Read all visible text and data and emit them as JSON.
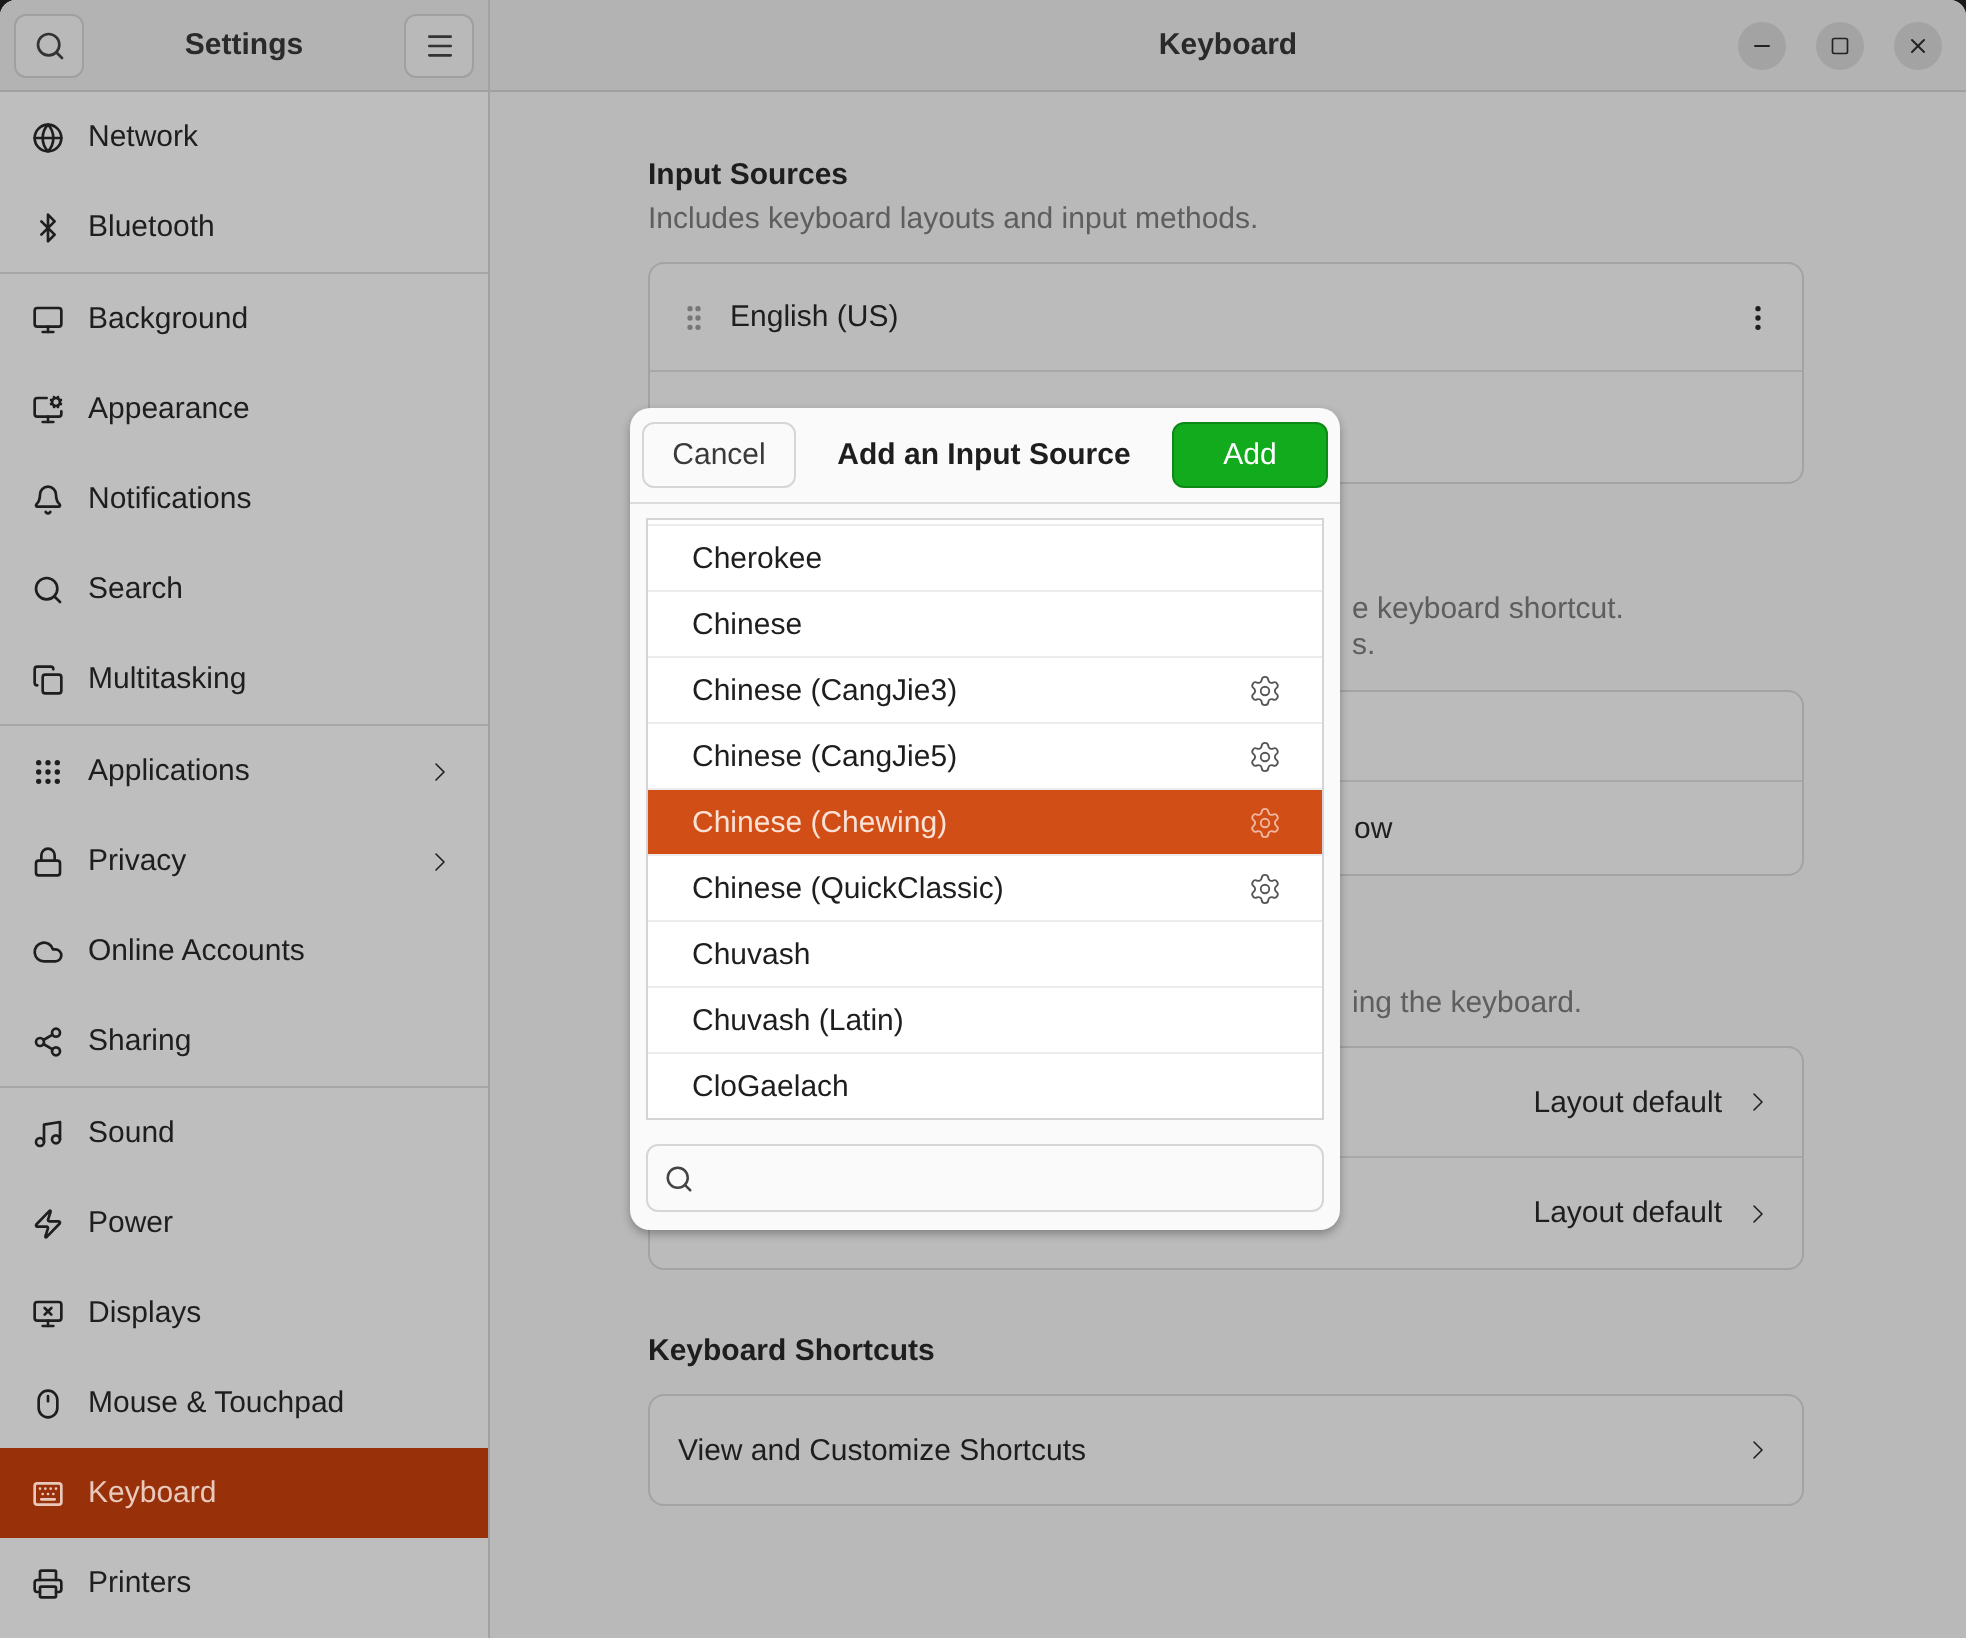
{
  "sidebar": {
    "title": "Settings",
    "groups": [
      {
        "items": [
          {
            "label": "Network",
            "selected": false,
            "submenu": false
          },
          {
            "label": "Bluetooth",
            "selected": false,
            "submenu": false
          }
        ]
      },
      {
        "items": [
          {
            "label": "Background",
            "selected": false,
            "submenu": false
          },
          {
            "label": "Appearance",
            "selected": false,
            "submenu": false
          },
          {
            "label": "Notifications",
            "selected": false,
            "submenu": false
          },
          {
            "label": "Search",
            "selected": false,
            "submenu": false
          },
          {
            "label": "Multitasking",
            "selected": false,
            "submenu": false
          }
        ]
      },
      {
        "items": [
          {
            "label": "Applications",
            "selected": false,
            "submenu": true
          },
          {
            "label": "Privacy",
            "selected": false,
            "submenu": true
          },
          {
            "label": "Online Accounts",
            "selected": false,
            "submenu": false
          },
          {
            "label": "Sharing",
            "selected": false,
            "submenu": false
          }
        ]
      },
      {
        "items": [
          {
            "label": "Sound",
            "selected": false,
            "submenu": false
          },
          {
            "label": "Power",
            "selected": false,
            "submenu": false
          },
          {
            "label": "Displays",
            "selected": false,
            "submenu": false
          },
          {
            "label": "Mouse & Touchpad",
            "selected": false,
            "submenu": false
          },
          {
            "label": "Keyboard",
            "selected": true,
            "submenu": false
          },
          {
            "label": "Printers",
            "selected": false,
            "submenu": false
          }
        ]
      }
    ]
  },
  "main": {
    "title": "Keyboard",
    "input_sources": {
      "title": "Input Sources",
      "subtitle": "Includes keyboard layouts and input methods.",
      "source": "English (US)"
    },
    "switching": {
      "subtitle_lines": [
        "e keyboard shortcut.",
        "s."
      ],
      "row": "ow"
    },
    "special": {
      "subtitle": "ing the keyboard.",
      "rows": [
        {
          "value": "Layout default"
        },
        {
          "value": "Layout default"
        }
      ]
    },
    "shortcuts": {
      "title": "Keyboard Shortcuts",
      "row": "View and Customize Shortcuts"
    }
  },
  "dialog": {
    "title": "Add an Input Source",
    "cancel": "Cancel",
    "add": "Add",
    "items": [
      {
        "label": "Cherokee",
        "settings": false,
        "selected": false
      },
      {
        "label": "Chinese",
        "settings": false,
        "selected": false
      },
      {
        "label": "Chinese (CangJie3)",
        "settings": true,
        "selected": false
      },
      {
        "label": "Chinese (CangJie5)",
        "settings": true,
        "selected": false
      },
      {
        "label": "Chinese (Chewing)",
        "settings": true,
        "selected": true
      },
      {
        "label": "Chinese (QuickClassic)",
        "settings": true,
        "selected": false
      },
      {
        "label": "Chuvash",
        "settings": false,
        "selected": false
      },
      {
        "label": "Chuvash (Latin)",
        "settings": false,
        "selected": false
      },
      {
        "label": "CloGaelach",
        "settings": false,
        "selected": false
      }
    ]
  }
}
